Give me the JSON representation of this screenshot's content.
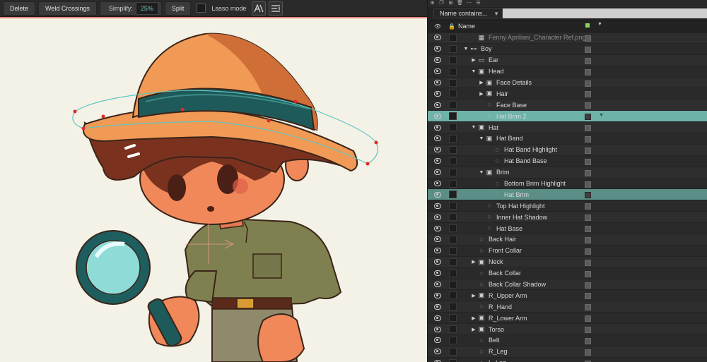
{
  "toolbar": {
    "delete_label": "Delete",
    "weld_label": "Weld Crossings",
    "simplify_label": "Simplify:",
    "simplify_value": "25%",
    "split_label": "Split",
    "lasso_label": "Lasso mode"
  },
  "panel": {
    "filter_label": "Name contains...",
    "column_name": "Name",
    "layers": [
      {
        "name": "Fenny Apriliani_Character Ref.png",
        "depth": 1,
        "arrow": "",
        "icon": "image-icon",
        "dim": true
      },
      {
        "name": "Boy",
        "depth": 0,
        "arrow": "▼",
        "icon": "bone-icon"
      },
      {
        "name": "Ear",
        "depth": 1,
        "arrow": "▶",
        "icon": "folder-icon"
      },
      {
        "name": "Head",
        "depth": 1,
        "arrow": "▼",
        "icon": "group-icon"
      },
      {
        "name": "Face Details",
        "depth": 2,
        "arrow": "▶",
        "icon": "group-icon"
      },
      {
        "name": "Hair",
        "depth": 2,
        "arrow": "▶",
        "icon": "group-icon"
      },
      {
        "name": "Face Base",
        "depth": 2,
        "arrow": "",
        "icon": "vector-icon"
      },
      {
        "name": "Hat Brim 2",
        "depth": 2,
        "arrow": "",
        "icon": "vector-icon",
        "selected": 1
      },
      {
        "name": "Hat",
        "depth": 1,
        "arrow": "▼",
        "icon": "group-icon"
      },
      {
        "name": "Hat Band",
        "depth": 2,
        "arrow": "▼",
        "icon": "group-icon"
      },
      {
        "name": "Hat Band Highlight",
        "depth": 3,
        "arrow": "",
        "icon": "vector-icon"
      },
      {
        "name": "Hat Band Base",
        "depth": 3,
        "arrow": "",
        "icon": "vector-icon"
      },
      {
        "name": "Brim",
        "depth": 2,
        "arrow": "▼",
        "icon": "group-icon"
      },
      {
        "name": "Bottom Brim Highlight",
        "depth": 3,
        "arrow": "",
        "icon": "vector-icon"
      },
      {
        "name": "Hat Brim",
        "depth": 3,
        "arrow": "",
        "icon": "vector-icon",
        "selected": 2
      },
      {
        "name": "Top Hat Highlight",
        "depth": 2,
        "arrow": "",
        "icon": "vector-icon"
      },
      {
        "name": "Inner Hat Shadow",
        "depth": 2,
        "arrow": "",
        "icon": "vector-icon"
      },
      {
        "name": "Hat Base",
        "depth": 2,
        "arrow": "",
        "icon": "vector-icon"
      },
      {
        "name": "Back Hair",
        "depth": 1,
        "arrow": "",
        "icon": "vector-icon"
      },
      {
        "name": "Front Collar",
        "depth": 1,
        "arrow": "",
        "icon": "vector-icon"
      },
      {
        "name": "Neck",
        "depth": 1,
        "arrow": "▶",
        "icon": "group-icon"
      },
      {
        "name": "Back Collar",
        "depth": 1,
        "arrow": "",
        "icon": "vector-icon"
      },
      {
        "name": "Back Collar Shadow",
        "depth": 1,
        "arrow": "",
        "icon": "vector-icon"
      },
      {
        "name": "R_Upper Arm",
        "depth": 1,
        "arrow": "▶",
        "icon": "group-icon"
      },
      {
        "name": "R_Hand",
        "depth": 1,
        "arrow": "",
        "icon": "vector-icon"
      },
      {
        "name": "R_Lower Arm",
        "depth": 1,
        "arrow": "▶",
        "icon": "group-icon"
      },
      {
        "name": "Torso",
        "depth": 1,
        "arrow": "▶",
        "icon": "group-icon"
      },
      {
        "name": "Belt",
        "depth": 1,
        "arrow": "",
        "icon": "vector-icon"
      },
      {
        "name": "R_Leg",
        "depth": 1,
        "arrow": "",
        "icon": "vector-icon"
      },
      {
        "name": "L_Leg",
        "depth": 1,
        "arrow": "",
        "icon": "vector-icon"
      }
    ]
  },
  "colors": {
    "selected_row": "#6eb3a8",
    "selected_row_alt": "#5a8e86",
    "canvas_bg": "#f4f1e6",
    "path_stroke": "#5ec6c0",
    "anchor_point": "#e02828"
  }
}
